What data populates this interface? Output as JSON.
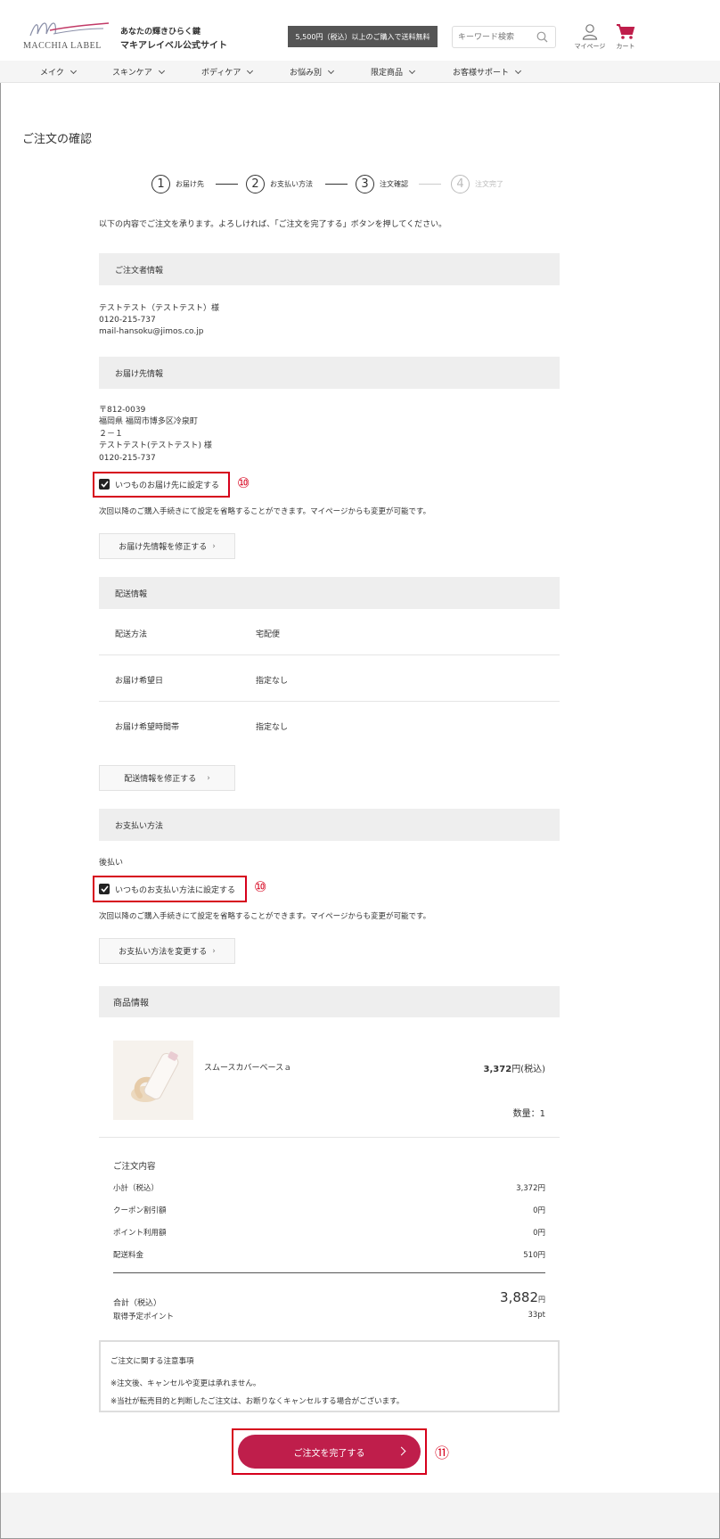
{
  "header": {
    "logo_text": "MACCHIA LABEL",
    "tagline": "あなたの輝きひらく鍵",
    "site_name": "マキアレイベル公式サイト",
    "shipping_banner": "5,500円（税込）以上のご購入で送料無料",
    "search_placeholder": "キーワード検索",
    "mypage_label": "マイページ",
    "cart_label": "カート",
    "accent_color": "#bf1e4b"
  },
  "nav": {
    "items": [
      {
        "label": "メイク"
      },
      {
        "label": "スキンケア"
      },
      {
        "label": "ボディケア"
      },
      {
        "label": "お悩み別"
      },
      {
        "label": "限定商品"
      },
      {
        "label": "お客様サポート"
      }
    ]
  },
  "page": {
    "title": "ご注文の確認",
    "intro": "以下の内容でご注文を承ります。よろしければ、「ご注文を完了する」ボタンを押してください。"
  },
  "steps": [
    {
      "num": "1",
      "label": "お届け先"
    },
    {
      "num": "2",
      "label": "お支払い方法"
    },
    {
      "num": "3",
      "label": "注文確認"
    },
    {
      "num": "4",
      "label": "注文完了"
    }
  ],
  "orderer": {
    "heading": "ご注文者情報",
    "name": "テストテスト（テストテスト）様",
    "phone": "0120-215-737",
    "email": "mail-hansoku@jimos.co.jp"
  },
  "delivery": {
    "heading": "お届け先情報",
    "zip": "〒812-0039",
    "address": "福岡県 福岡市博多区冷泉町",
    "address2": "２－１",
    "name": "テストテスト(テストテスト) 様",
    "phone": "0120-215-737",
    "default_checkbox": "いつものお届け先に設定する",
    "note": "次回以降のご購入手続きにて設定を省略することができます。マイページからも変更が可能です。",
    "edit_button": "お届け先情報を修正する",
    "badge": "⑩"
  },
  "shipping": {
    "heading": "配送情報",
    "rows": [
      {
        "key": "配送方法",
        "value": "宅配便"
      },
      {
        "key": "お届け希望日",
        "value": "指定なし"
      },
      {
        "key": "お届け希望時間帯",
        "value": "指定なし"
      }
    ],
    "edit_button": "配送情報を修正する"
  },
  "payment": {
    "heading": "お支払い方法",
    "method": "後払い",
    "default_checkbox": "いつものお支払い方法に設定する",
    "note": "次回以降のご購入手続きにて設定を省略することができます。マイページからも変更が可能です。",
    "edit_button": "お支払い方法を変更する",
    "badge": "⑩"
  },
  "products": {
    "heading": "商品情報",
    "items": [
      {
        "name": "スムースカバーベースａ",
        "price_num": "3,372",
        "price_suffix": "円(税込)",
        "qty": "数量：1"
      }
    ]
  },
  "summary": {
    "heading": "ご注文内容",
    "rows": [
      {
        "label": "小計（税込）",
        "value": "3,372円"
      },
      {
        "label": "クーポン割引額",
        "value": "0円"
      },
      {
        "label": "ポイント利用額",
        "value": "0円"
      },
      {
        "label": "配送料金",
        "value": "510円"
      }
    ],
    "total_label": "合計（税込）",
    "total_value": "3,882",
    "total_unit": "円",
    "points_label": "取得予定ポイント",
    "points_value": "33pt"
  },
  "notice": {
    "title": "ご注文に関する注意事項",
    "line1": "※注文後、キャンセルや変更は承れません。",
    "line2": "※当社が転売目的と判断したご注文は、お断りなくキャンセルする場合がございます。"
  },
  "complete": {
    "button": "ご注文を完了する",
    "badge": "⑪"
  }
}
